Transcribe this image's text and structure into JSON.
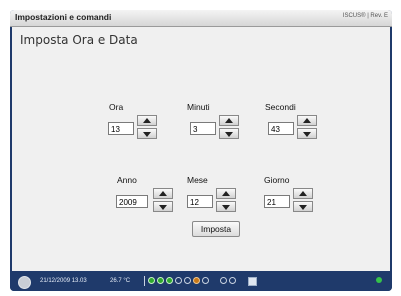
{
  "window": {
    "title": "Impostazioni e comandi",
    "brand": "ISCUS® | Rev. E"
  },
  "page": {
    "heading": "Imposta Ora e Data"
  },
  "fields": {
    "ora": {
      "label": "Ora",
      "value": "13"
    },
    "minuti": {
      "label": "Minuti",
      "value": "3"
    },
    "secondi": {
      "label": "Secondi",
      "value": "43"
    },
    "anno": {
      "label": "Anno",
      "value": "2009"
    },
    "mese": {
      "label": "Mese",
      "value": "12"
    },
    "giorno": {
      "label": "Giorno",
      "value": "21"
    }
  },
  "actions": {
    "apply_label": "Imposta"
  },
  "statusbar": {
    "datetime": "21/12/2009 13.03",
    "temperature": "26.7 °C",
    "indicator_colors": {
      "green": "#2ea82e",
      "orange": "#c87818"
    }
  },
  "colors": {
    "frame": "#1f3a6b",
    "panel": "#f0f0f0"
  }
}
